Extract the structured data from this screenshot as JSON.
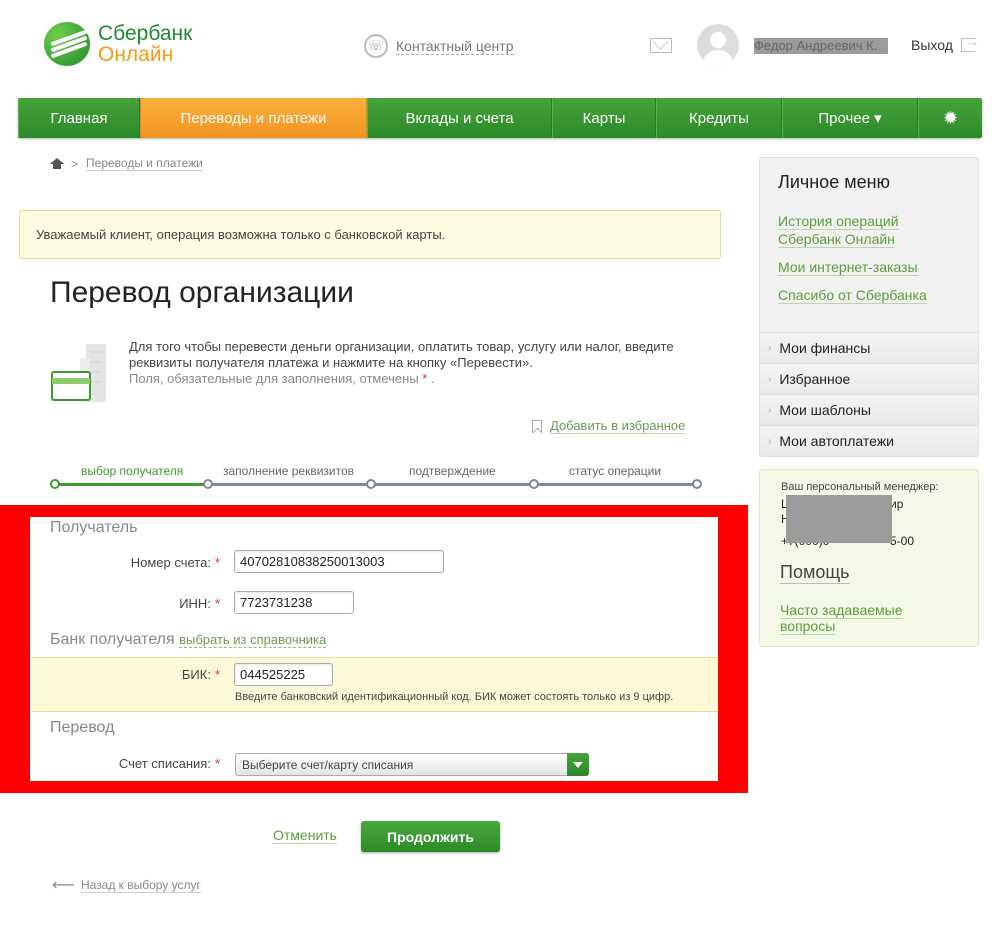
{
  "header": {
    "logo_line1": "Сбербанк",
    "logo_line2": "Онлайн",
    "contact_center": "Контактный центр",
    "user_name": "Федор Андреевич К.",
    "logout": "Выход"
  },
  "nav": {
    "items": [
      {
        "label": "Главная"
      },
      {
        "label": "Переводы и платежи"
      },
      {
        "label": "Вклады и счета"
      },
      {
        "label": "Карты"
      },
      {
        "label": "Кредиты"
      },
      {
        "label": "Прочее ▾"
      }
    ],
    "active_index": 1
  },
  "breadcrumb": {
    "separator": ">",
    "current": "Переводы и платежи"
  },
  "notice": "Уважаемый клиент, операция возможна только с банковской карты.",
  "page_title": "Перевод организации",
  "intro": {
    "text": "Для того чтобы перевести деньги организации, оплатить товар, услугу или налог, введите реквизиты получателя платежа и нажмите на кнопку «Перевести».",
    "required_note": "Поля, обязательные для заполнения, отмечены",
    "req_mark": "*",
    "dot": "."
  },
  "add_favorite": "Добавить в избранное",
  "steps": [
    {
      "label": "выбор получателя"
    },
    {
      "label": "заполнение реквизитов"
    },
    {
      "label": "подтверждение"
    },
    {
      "label": "статус операции"
    }
  ],
  "form": {
    "recipient_section": "Получатель",
    "account_label": "Номер счета:",
    "account_value": "40702810838250013003",
    "inn_label": "ИНН:",
    "inn_value": "7723731238",
    "bank_section": "Банк получателя",
    "bank_directory_link": "выбрать из справочника",
    "bik_label": "БИК:",
    "bik_value": "044525225",
    "bik_hint": "Введите банковский идентификационный код. БИК может состоять только из 9 цифр.",
    "transfer_section": "Перевод",
    "debit_label": "Счет списания:",
    "debit_placeholder": "Выберите счет/карту списания",
    "req_mark": "*"
  },
  "actions": {
    "cancel": "Отменить",
    "continue": "Продолжить",
    "back": "Назад к выбору услуг"
  },
  "personal_menu": {
    "title": "Личное меню",
    "links": [
      {
        "line1": "История операций",
        "line2": "Сбербанк Онлайн"
      },
      {
        "line1": "Мои интернет-заказы"
      },
      {
        "line1": "Спасибо от Сбербанка"
      }
    ],
    "items": [
      {
        "label": "Мои финансы"
      },
      {
        "label": "Избранное"
      },
      {
        "label": "Мои шаблоны"
      },
      {
        "label": "Мои автоплатежи"
      }
    ]
  },
  "manager": {
    "caption": "Ваш персональный менеджер:",
    "frag_a": "Ц",
    "frag_b": "Н",
    "frag_c": "ир",
    "frag_d": "+7(000)0",
    "frag_e": "5-00",
    "help": "Помощь",
    "faq_line1": "Часто задаваемые",
    "faq_line2": "вопросы"
  },
  "colors": {
    "brand_green": "#2b8a2a",
    "active_orange": "#f39323",
    "highlight_red": "#ff0000"
  }
}
